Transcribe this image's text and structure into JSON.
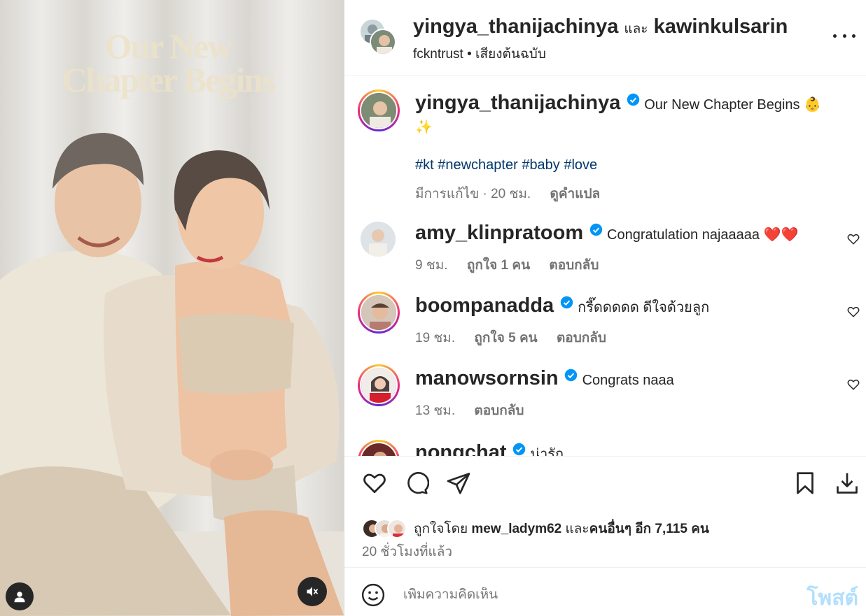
{
  "media": {
    "title_line1": "Our New",
    "title_line2": "Chapter Begins",
    "user_icon": "user-icon",
    "mute_icon": "speaker-muted-icon"
  },
  "header": {
    "user1": "yingya_thanijachinya",
    "and_text": "และ",
    "user2": "kawinkulsarin",
    "audio_user": "fckntrust",
    "audio_sep": "•",
    "audio_label": "เสียงต้นฉบับ",
    "more_icon": "more-options-icon"
  },
  "caption": {
    "username": "yingya_thanijachinya",
    "text": "Our New Chapter Begins 👶",
    "text2": "✨",
    "hashtags": "#kt #newchapter #baby #love",
    "edited": "มีการแก้ไข",
    "time": "20 ชม.",
    "translate": "ดูคำแปล"
  },
  "comments": [
    {
      "username": "amy_klinpratoom",
      "text": "Congratulation najaaaaa ❤️❤️",
      "time": "9 ชม.",
      "likes": "ถูกใจ 1 คน",
      "reply": "ตอบกลับ"
    },
    {
      "username": "boompanadda",
      "text": "กรี๊ดดดดด ดีใจด้วยลูก",
      "time": "19 ชม.",
      "likes": "ถูกใจ 5 คน",
      "reply": "ตอบกลับ"
    },
    {
      "username": "manowsornsin",
      "text": "Congrats naaa",
      "time": "13 ชม.",
      "likes": "",
      "reply": "ตอบกลับ"
    },
    {
      "username": "nongchat",
      "text": "น่ารัก",
      "time": "",
      "likes": "",
      "reply": ""
    }
  ],
  "actions": {
    "liked_by_prefix": "ถูกใจโดย",
    "liked_by_user": "mew_ladym62",
    "and_text": "และ",
    "others": "คนอื่นๆ อีก 7,115 คน",
    "time_ago": "20 ชั่วโมงที่แล้ว"
  },
  "add_comment": {
    "placeholder": "เพิ่มความคิดเห็น",
    "post_label": "โพสต์"
  },
  "colors": {
    "text": "#262626",
    "secondary": "#737373",
    "link": "#00376b",
    "verified": "#0095f6",
    "post_disabled": "#b2dffc",
    "heart": "#ed4956"
  }
}
